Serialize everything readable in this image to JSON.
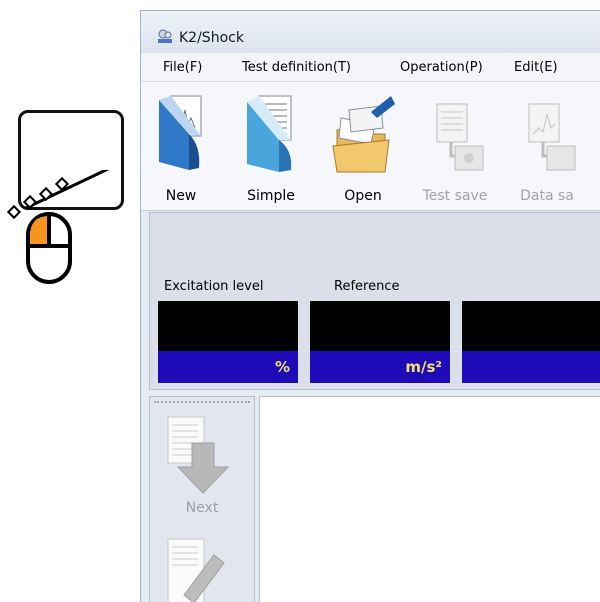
{
  "window": {
    "title": "K2/Shock"
  },
  "menubar": {
    "items": [
      {
        "label": "File(F)"
      },
      {
        "label": "Test definition(T)"
      },
      {
        "label": "Operation(P)"
      },
      {
        "label": "Edit(E)"
      }
    ]
  },
  "toolbar": {
    "buttons": [
      {
        "label": "New",
        "enabled": true,
        "icon": "new-document-icon"
      },
      {
        "label": "Simple",
        "enabled": true,
        "icon": "simple-document-icon"
      },
      {
        "label": "Open",
        "enabled": true,
        "icon": "open-folder-icon"
      },
      {
        "label": "Test save",
        "enabled": false,
        "icon": "test-save-icon"
      },
      {
        "label": "Data sa",
        "enabled": false,
        "icon": "data-save-icon"
      }
    ]
  },
  "meters": [
    {
      "caption": "Excitation level",
      "unit": "%"
    },
    {
      "caption": "Reference",
      "unit": "m/s²"
    },
    {
      "caption": "",
      "unit": ""
    }
  ],
  "side_panel": {
    "next_label": "Next"
  },
  "colors": {
    "meter_unit_bg": "#1e0ab8",
    "meter_unit_text": "#f0e26a",
    "annotation_accent": "#f7941d"
  },
  "annotation": {
    "icon": "mouse-click-icon"
  }
}
